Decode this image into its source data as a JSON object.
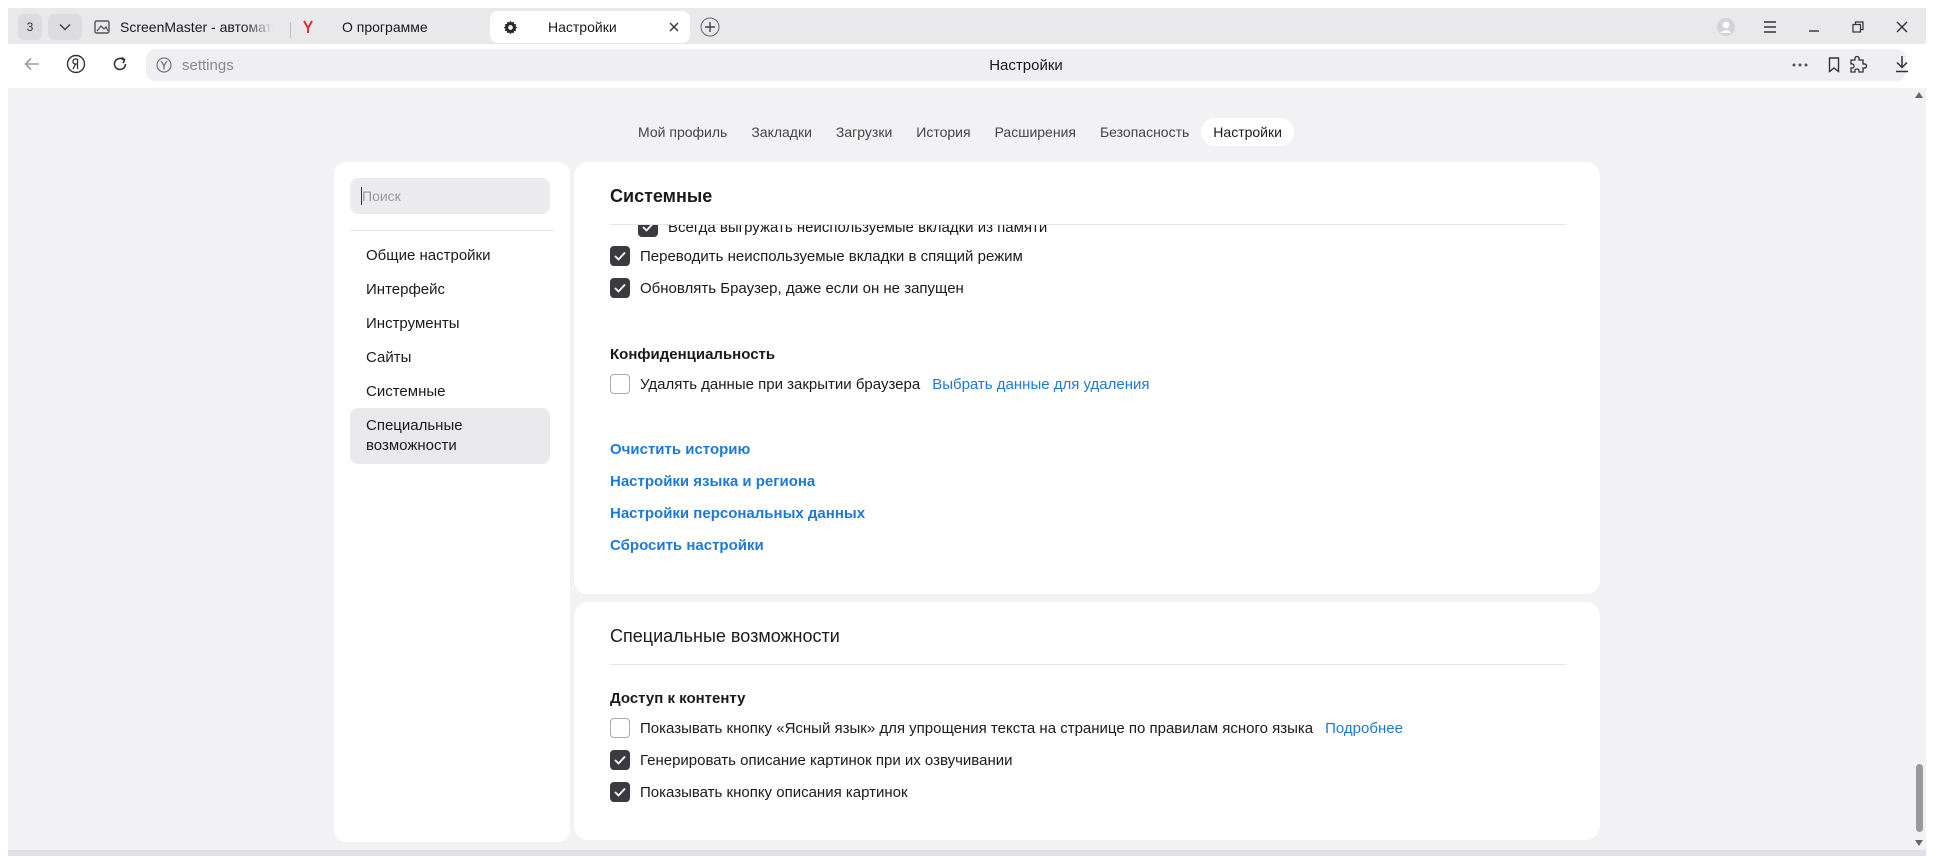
{
  "browser": {
    "tab_count": "3",
    "tabs": [
      {
        "title": "ScreenMaster - автоматизация"
      },
      {
        "title": "О программе"
      },
      {
        "title": "Настройки"
      }
    ],
    "address": {
      "url": "settings",
      "page_title": "Настройки"
    }
  },
  "nav": {
    "tabs": [
      "Мой профиль",
      "Закладки",
      "Загрузки",
      "История",
      "Расширения",
      "Безопасность",
      "Настройки"
    ],
    "active": "Настройки"
  },
  "sidebar": {
    "search_placeholder": "Поиск",
    "items": [
      {
        "label": "Общие настройки"
      },
      {
        "label": "Интерфейс"
      },
      {
        "label": "Инструменты"
      },
      {
        "label": "Сайты"
      },
      {
        "label": "Системные"
      },
      {
        "label": "Специальные возможности",
        "active": true
      }
    ]
  },
  "system": {
    "title": "Системные",
    "partial_row": "Всегда выгружать неиспользуемые вкладки из памяти",
    "rows": [
      {
        "label": "Переводить неиспользуемые вкладки в спящий режим",
        "checked": true
      },
      {
        "label": "Обновлять Браузер, даже если он не запущен",
        "checked": true
      }
    ],
    "privacy": {
      "title": "Конфиденциальность",
      "row_label": "Удалять данные при закрытии браузера",
      "row_checked": false,
      "row_link": "Выбрать данные для удаления"
    },
    "links": [
      "Очистить историю",
      "Настройки языка и региона",
      "Настройки персональных данных",
      "Сбросить настройки"
    ]
  },
  "accessibility": {
    "title": "Специальные возможности",
    "content_access": {
      "title": "Доступ к контенту",
      "rows": [
        {
          "label": "Показывать кнопку «Ясный язык» для упрощения текста на странице по правилам ясного языка",
          "checked": false,
          "link": "Подробнее"
        },
        {
          "label": "Генерировать описание картинок при их озвучивании",
          "checked": true
        },
        {
          "label": "Показывать кнопку описания картинок",
          "checked": true
        }
      ]
    }
  },
  "colors": {
    "accent_link": "#1e79d6",
    "checkbox_on": "#3b3b3f",
    "page_bg": "#f2f2f4"
  }
}
